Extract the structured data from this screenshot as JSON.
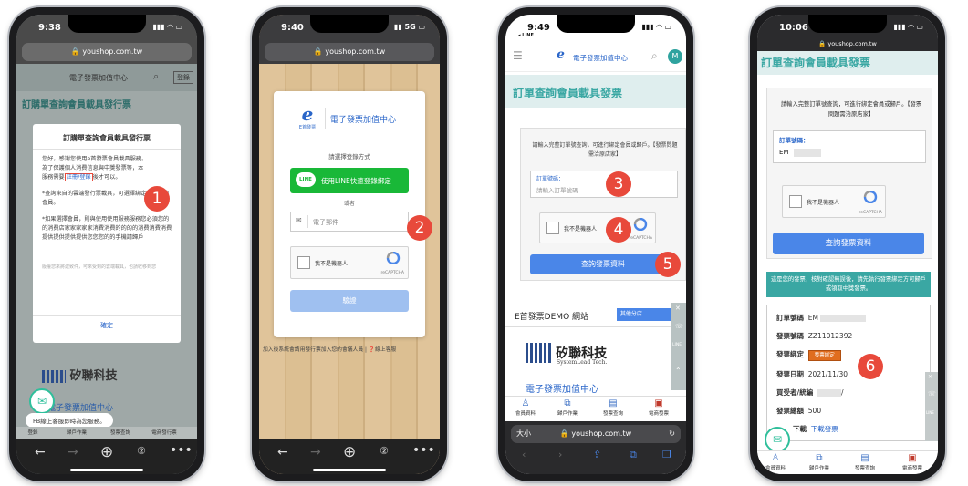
{
  "phones": [
    {
      "time": "9:38",
      "url": "youshop.com.tw",
      "brand": "電子發票加值中心",
      "top_button": "登錄",
      "page_title": "訂購單查詢會員載具發行票",
      "modal": {
        "title": "訂購單查詢會員載具發行票",
        "para1_a": "您好，感謝您使用e首發票會員載具服務。",
        "para1_b": "為了保護個人消費信息與中獎發票等，本",
        "para1_c": "服務需要",
        "link": "註冊/登錄",
        "para1_d": "後才可以。",
        "bullet1": "*查詢來自的雲端發行票載具，可選擇綁定為加入的會員。",
        "bullet2": "*如果選擇會員，則與使用使用服務服務您必須您的的消費店家家家家家消費消費的的的的消費消費消費提供提供提供提供您您您的的手機請歸戶",
        "note": "版權您來將建致件，可來受到的雲端載具，也請收移到您",
        "confirm": "確定"
      },
      "brand_cn": "矽聯科技",
      "brand_sub": "電子發票加值中心",
      "chat_text": "FB線上客服即時為您服務。",
      "nav": [
        "登錄",
        "歸戶作業",
        "發票查詢",
        "電商發行票"
      ],
      "badge": "1"
    },
    {
      "time": "9:40",
      "signal": "5G",
      "url": "youshop.com.tw",
      "logo_text": "E首發票",
      "brand": "電子發票加值中心",
      "login_method": "請選擇登錄方式",
      "line_button": "使用LINE快速登錄綁定",
      "or": "或者",
      "email_placeholder": "電子郵件",
      "captcha_label": "我不是機器人",
      "captcha_brand": "reCAPTCHA",
      "submit": "驗證",
      "footer": "加入後系統會請用發行票加入您的會議人員",
      "help": "線上客服",
      "badge": "2"
    },
    {
      "time": "9:49",
      "carrier": "LINE",
      "brand": "電子發票加值中心",
      "avatar": "M",
      "page_title": "訂單查詢會員載具發票",
      "intro": "請輸入完整訂單號查詢，可進行綁定會員或歸戶。【發票問題需洽原店家】",
      "order_label": "訂單號碼：",
      "order_placeholder": "請輸入訂單號碼",
      "captcha_label": "我不是機器人",
      "captcha_brand": "reCAPTCHA",
      "query_button": "查詢發票資料",
      "demo_title": "E首發票DEMO 網站",
      "demo_select": "其他分店",
      "brand_cn": "矽聯科技",
      "brand_en": "SystemLead Tech.",
      "brand_sub": "電子發票加值中心",
      "nav": [
        "會員資料",
        "歸戶作業",
        "發票查詢",
        "電商發票"
      ],
      "size_label": "大小",
      "url": "youshop.com.tw",
      "badges": [
        "3",
        "4",
        "5"
      ]
    },
    {
      "time": "10:06",
      "url": "youshop.com.tw",
      "page_title": "訂單查詢會員載具發票",
      "intro": "請輸入完整訂單號查詢，可進行綁定會員或歸戶。【發票問題需洽原店家】",
      "order_label": "訂單號碼：",
      "order_value": "EM",
      "captcha_label": "我不是機器人",
      "captcha_brand": "reCAPTCHA",
      "query_button": "查詢發票資料",
      "notice": "這是您的發票，核對確認無誤後，請先執行發票綁定方可歸戶或領取中獎發票。",
      "rows": [
        {
          "label": "訂單號碼",
          "value": "EM"
        },
        {
          "label": "發票號碼",
          "value": "ZZ11012392"
        },
        {
          "label": "發票綁定",
          "value": "發票綁定"
        },
        {
          "label": "發票日期",
          "value": "2021/11/30"
        },
        {
          "label": "買受者/統編",
          "value": "/"
        },
        {
          "label": "發票總額",
          "value": "500"
        },
        {
          "label": "下載",
          "value": "下載發票"
        }
      ],
      "nav": [
        "會員資料",
        "歸戶作業",
        "發票查詢",
        "電商發票"
      ],
      "badge": "6"
    }
  ],
  "colors": {
    "line_green": "#19b838",
    "primary_blue": "#4a86e8",
    "badge_red": "#e8493b",
    "teal": "#3aa7a3",
    "orange": "#e06d1f"
  }
}
